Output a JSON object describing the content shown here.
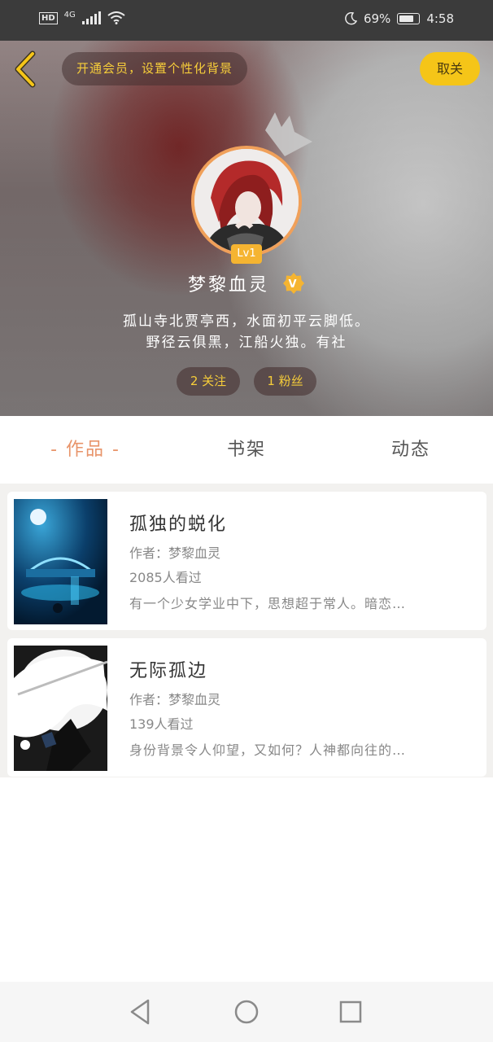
{
  "status_bar": {
    "network": "4G",
    "hd": "HD",
    "battery": "69%",
    "time": "4:58",
    "icons": [
      "hd-icon",
      "signal-icon",
      "wifi-icon",
      "moon-icon",
      "battery-icon"
    ]
  },
  "header": {
    "vip_banner": "开通会员，设置个性化背景",
    "follow_label": "取关",
    "level": "Lv1",
    "username": "梦黎血灵",
    "verified_badge": "V",
    "bio_line1": "孤山寺北贾亭西，水面初平云脚低。",
    "bio_line2": "野径云俱黑，江船火独。有社",
    "following": "2 关注",
    "followers": "1 粉丝"
  },
  "tabs": [
    {
      "label": "- 作品 -",
      "active": true
    },
    {
      "label": "书架",
      "active": false
    },
    {
      "label": "动态",
      "active": false
    }
  ],
  "works": [
    {
      "title": "孤独的蜕化",
      "author": "作者：梦黎血灵",
      "reads": "2085人看过",
      "desc": "有一个少女学业中下，思想超于常人。暗恋…"
    },
    {
      "title": "无际孤边",
      "author": "作者：梦黎血灵",
      "reads": "139人看过",
      "desc": "身份背景令人仰望，又如何？人神都向往的…"
    }
  ],
  "colors": {
    "accent": "#e8946a",
    "vip_text": "#f6cd3a",
    "follow_button": "#f5c518",
    "status_bar": "#3b3b3b"
  }
}
